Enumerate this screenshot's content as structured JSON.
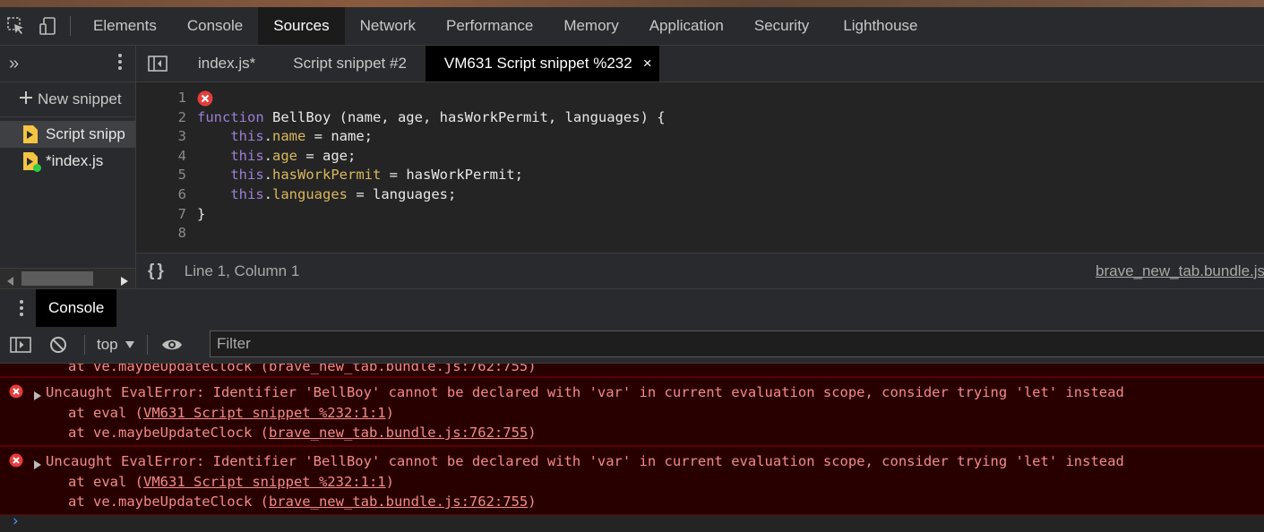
{
  "topbar": {
    "tabs": [
      "Elements",
      "Console",
      "Sources",
      "Network",
      "Performance",
      "Memory",
      "Application",
      "Security",
      "Lighthouse"
    ],
    "active_tab": "Sources"
  },
  "sidebar": {
    "more_tabs_glyph": "»",
    "new_snippet": "New snippet",
    "items": [
      {
        "label": "Script snipp",
        "selected": true,
        "modified": false
      },
      {
        "label": "*index.js",
        "selected": false,
        "modified": true
      }
    ]
  },
  "editor": {
    "tabs": [
      {
        "label": "index.js*",
        "active": false
      },
      {
        "label": "Script snippet #2",
        "active": false
      },
      {
        "label": "VM631 Script snippet %232",
        "active": true,
        "closable": true
      }
    ],
    "close_glyph": "×",
    "line_numbers": [
      "1",
      "2",
      "3",
      "4",
      "5",
      "6",
      "7",
      "8"
    ],
    "status_text": "Line 1, Column 1",
    "pretty_print_glyph": "{}",
    "status_source_link": "brave_new_tab.bundle.js"
  },
  "drawer": {
    "tab": "Console"
  },
  "console_toolbar": {
    "context": "top",
    "filter_placeholder": "Filter"
  },
  "console": {
    "partial_line": "at ve.maybeUpdateClock (brave_new_tab.bundle.js:762:755)",
    "messages": [
      {
        "text": "Uncaught EvalError: Identifier 'BellBoy' cannot be declared with 'var' in current evaluation scope, consider trying 'let' instead",
        "stack1_prefix": "at eval (",
        "stack1_link": "VM631 Script snippet %232:1:1",
        "stack1_suffix": ")",
        "stack2_prefix": "at ve.maybeUpdateClock (",
        "stack2_link": "brave_new_tab.bundle.js:762:755",
        "stack2_suffix": ")"
      },
      {
        "text": "Uncaught EvalError: Identifier 'BellBoy' cannot be declared with 'var' in current evaluation scope, consider trying 'let' instead",
        "stack1_prefix": "at eval (",
        "stack1_link": "VM631 Script snippet %232:1:1",
        "stack1_suffix": ")",
        "stack2_prefix": "at ve.maybeUpdateClock (",
        "stack2_link": "brave_new_tab.bundle.js:762:755",
        "stack2_suffix": ")"
      }
    ],
    "prompt_glyph": "›"
  },
  "colors": {
    "panel": "#292a2d",
    "editor_bg": "#242424",
    "error_bg": "#290000",
    "error_text": "#f38b8b",
    "keyword": "#9a7fd4",
    "property": "#d9b85c",
    "snippet_icon": "#f4c542",
    "modified_dot": "#2ecc40"
  },
  "icons": [
    "inspect-element-icon",
    "device-toolbar-icon",
    "more-vertical-icon",
    "plus-icon",
    "snippet-file-icon",
    "toggle-navigator-icon",
    "error-icon",
    "pretty-print-icon",
    "sidebar-toggle-icon",
    "clear-console-icon",
    "dropdown-arrow-icon",
    "eye-icon",
    "expand-arrow-icon",
    "prompt-icon",
    "scroll-left-icon",
    "scroll-right-icon"
  ]
}
